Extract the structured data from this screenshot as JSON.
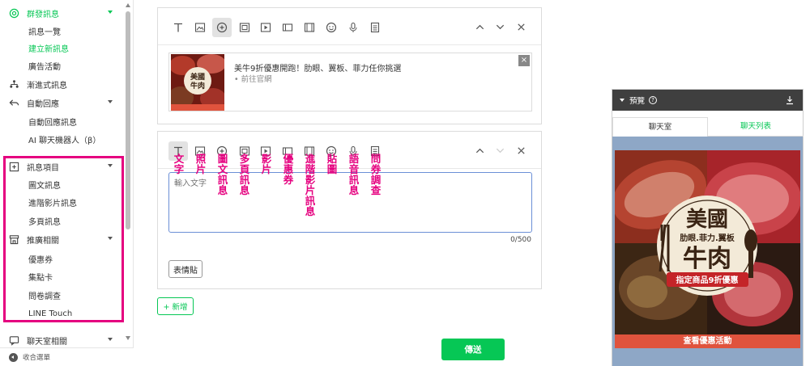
{
  "sidebar": {
    "items": [
      {
        "type": "sec",
        "icon": "broadcast-icon",
        "label": "群發訊息",
        "green": true,
        "chevron": true
      },
      {
        "type": "sub",
        "label": "訊息一覽"
      },
      {
        "type": "sub",
        "label": "建立新訊息",
        "green": true
      },
      {
        "type": "sub",
        "label": "廣告活動"
      },
      {
        "type": "sec",
        "icon": "step-message-icon",
        "label": "漸進式訊息"
      },
      {
        "type": "sec",
        "icon": "auto-reply-icon",
        "label": "自動回應",
        "chevron": true
      },
      {
        "type": "sub",
        "label": "自動回應訊息"
      },
      {
        "type": "sub",
        "label": "AI 聊天機器人（β）"
      },
      {
        "type": "sec",
        "icon": "message-item-icon",
        "label": "訊息項目",
        "chevron": true
      },
      {
        "type": "sub",
        "label": "圖文訊息"
      },
      {
        "type": "sub",
        "label": "進階影片訊息"
      },
      {
        "type": "sub",
        "label": "多頁訊息"
      },
      {
        "type": "sec",
        "icon": "store-icon",
        "label": "推廣相關",
        "chevron": true
      },
      {
        "type": "sub",
        "label": "優惠券"
      },
      {
        "type": "sub",
        "label": "集點卡"
      },
      {
        "type": "sub",
        "label": "問卷調查"
      },
      {
        "type": "sub",
        "label": "LINE Touch"
      },
      {
        "type": "sec",
        "icon": "chat-icon",
        "label": "聊天室相關",
        "chevron": true
      }
    ],
    "footer_label": "收合選單"
  },
  "composer": {
    "card1": {
      "rich_title": "美牛9折優惠開跑！肋眼、翼板、菲力任你挑選",
      "rich_link": "• 前往官網"
    },
    "card2": {
      "placeholder": "輸入文字",
      "char_count": "0/500",
      "emoji_button": "表情貼"
    },
    "add_button": "+ 新增",
    "send_button": "傳送"
  },
  "annotations": [
    "文字",
    "照片",
    "圖文訊息",
    "多頁訊息",
    "影片",
    "優惠券",
    "進階影片訊息",
    "貼圖",
    "語音訊息",
    "問券調查"
  ],
  "preview": {
    "title": "預覽",
    "tab_chat": "聊天室",
    "tab_list": "聊天列表",
    "banner": {
      "line1": "美國",
      "line2": "肋眼.菲力.翼板",
      "line3": "牛肉",
      "ribbon": "指定商品9折優惠",
      "cta": "查看優惠活動"
    }
  },
  "colors": {
    "brand_green": "#06c755",
    "highlight_pink": "#e5007f",
    "cta_red": "#e0533d"
  }
}
